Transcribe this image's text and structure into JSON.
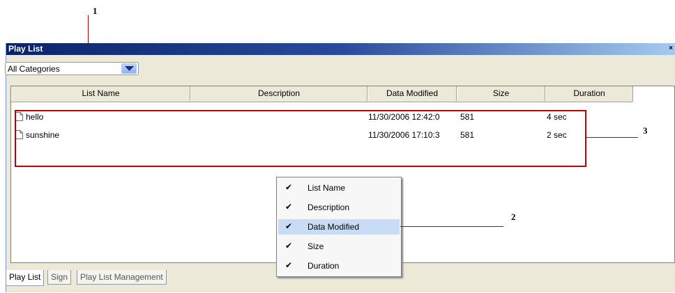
{
  "callouts": {
    "c1": "1",
    "c2": "2",
    "c3": "3"
  },
  "window": {
    "title": "Play List",
    "close_glyph": "×"
  },
  "category_combo": {
    "value": "All Categories"
  },
  "columns": [
    "List Name",
    "Description",
    "Data Modified",
    "Size",
    "Duration"
  ],
  "rows": [
    {
      "name": "hello",
      "modified": "11/30/2006 12:42:0",
      "size": "581",
      "duration": "4 sec"
    },
    {
      "name": "sunshine",
      "modified": "11/30/2006 17:10:3",
      "size": "581",
      "duration": "2 sec"
    }
  ],
  "context_menu": {
    "check_glyph": "✔",
    "items": [
      "List Name",
      "Description",
      "Data Modified",
      "Size",
      "Duration"
    ],
    "highlighted": "Data Modified"
  },
  "tabs": [
    "Play List",
    "Sign",
    "Play List Management"
  ],
  "colors": {
    "callout_line": "#c00000",
    "highlight": "#c8ddf5",
    "title_bar": "#0a246a"
  },
  "icons": {
    "row_icon": "file-icon",
    "combo_arrow": "chevron-down-icon"
  }
}
